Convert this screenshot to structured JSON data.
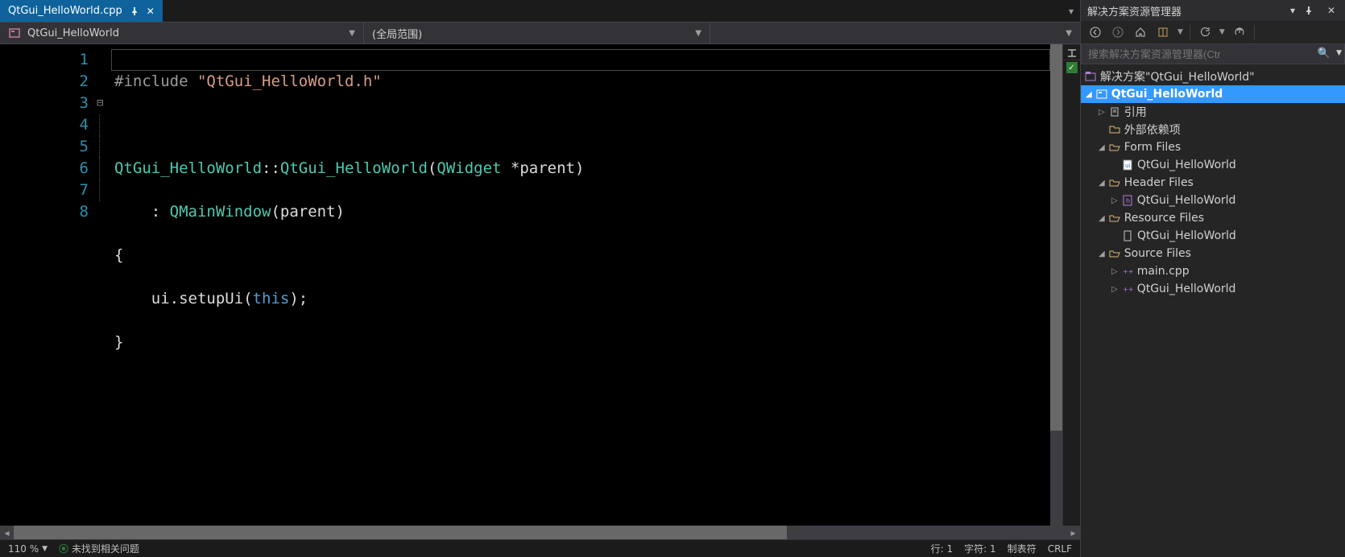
{
  "tab": {
    "title": "QtGui_HelloWorld.cpp"
  },
  "nav": {
    "class_selected": "QtGui_HelloWorld",
    "scope_selected": "(全局范围)"
  },
  "code": {
    "lines_count": 8,
    "l1_pp": "#include ",
    "l1_str": "\"QtGui_HelloWorld.h\"",
    "l3_t1": "QtGui_HelloWorld",
    "l3_op": "::",
    "l3_t2": "QtGui_HelloWorld",
    "l3_par": "(",
    "l3_t3": "QWidget",
    "l3_rest": " *parent)",
    "l4_indent": "    : ",
    "l4_t1": "QMainWindow",
    "l4_rest": "(parent)",
    "l5": "{",
    "l6_a": "    ui.setupUi(",
    "l6_kw": "this",
    "l6_b": ");",
    "l7": "}"
  },
  "status": {
    "zoom": "110 %",
    "issues": "未找到相关问题",
    "line_label": "行:",
    "line": "1",
    "col_label": "字符:",
    "col": "1",
    "tabs": "制表符",
    "eol": "CRLF"
  },
  "se": {
    "title": "解决方案资源管理器",
    "search_placeholder": "搜索解决方案资源管理器(Ctr",
    "solution_label": "解决方案\"QtGui_HelloWorld\"",
    "project": "QtGui_HelloWorld",
    "refs": "引用",
    "ext_deps": "外部依赖项",
    "form_files": "Form Files",
    "form_file_1": "QtGui_HelloWorld",
    "header_files": "Header Files",
    "header_file_1": "QtGui_HelloWorld",
    "resource_files": "Resource Files",
    "resource_file_1": "QtGui_HelloWorld",
    "source_files": "Source Files",
    "source_file_1": "main.cpp",
    "source_file_2": "QtGui_HelloWorld"
  }
}
